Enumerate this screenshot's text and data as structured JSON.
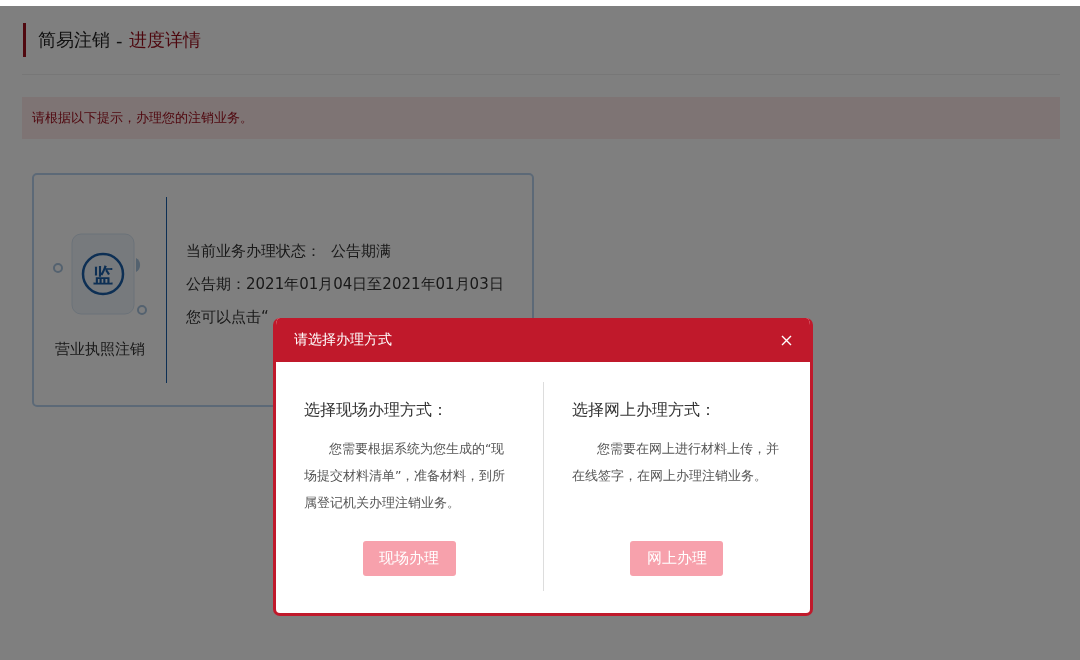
{
  "header": {
    "title": "简易注销",
    "separator": "-",
    "subtitle": "进度详情"
  },
  "hint": "请根据以下提示，办理您的注销业务。",
  "card": {
    "icon_text": "监",
    "label": "营业执照注销",
    "lines": [
      "当前业务办理状态：  公告期满",
      "公告期：2021年01月04日至2021年01月03日",
      "您可以点击“"
    ]
  },
  "dialog": {
    "title": "请选择办理方式",
    "options": [
      {
        "heading": "选择现场办理方式：",
        "description": "您需要根据系统为您生成的“现场提交材料清单”，准备材料，到所属登记机关办理注销业务。",
        "button": "现场办理"
      },
      {
        "heading": "选择网上办理方式：",
        "description": "您需要在网上进行材料上传，并在线签字，在网上办理注销业务。",
        "button": "网上办理"
      }
    ]
  }
}
